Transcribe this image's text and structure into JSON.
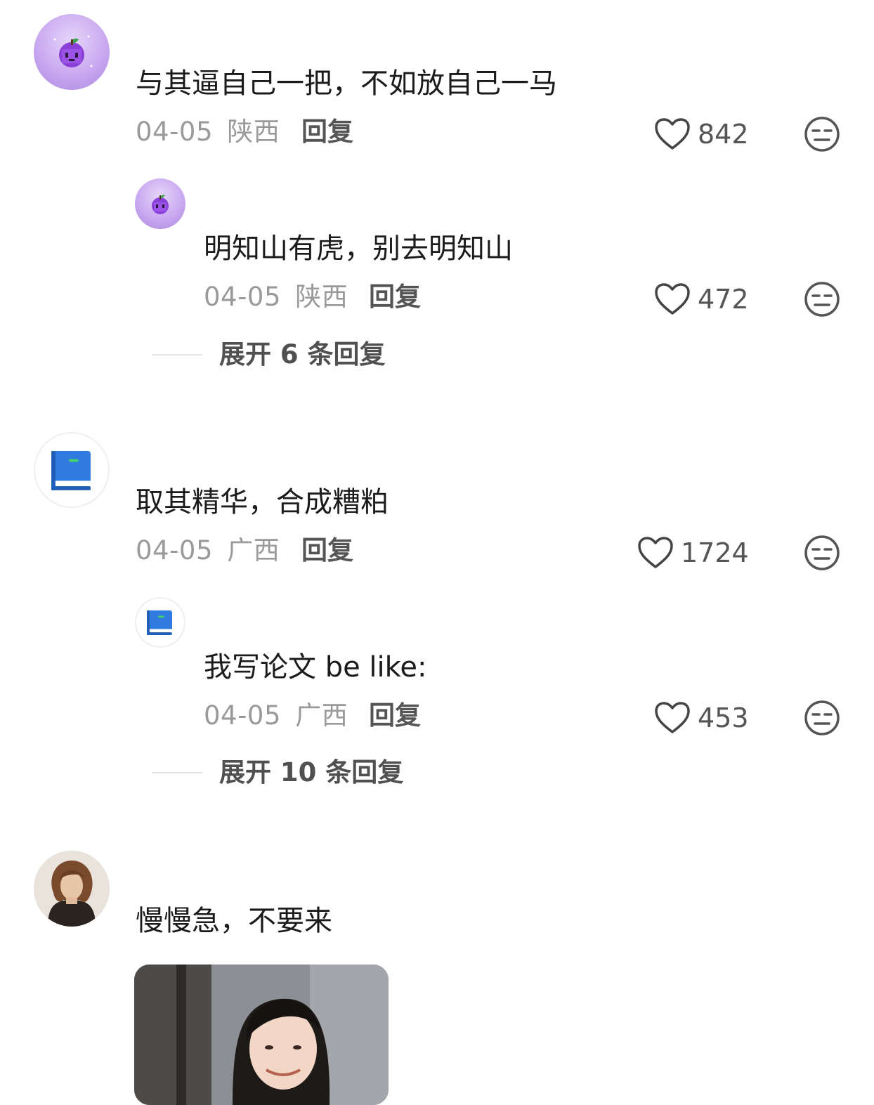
{
  "comments": [
    {
      "text": "与其逼自己一把，不如放自己一马",
      "date": "04-05",
      "location": "陕西",
      "reply_label": "回复",
      "likes": "842",
      "avatar_icon": "grape-icon",
      "replies": [
        {
          "text": "明知山有虎，别去明知山",
          "date": "04-05",
          "location": "陕西",
          "reply_label": "回复",
          "likes": "472",
          "avatar_icon": "grape-icon"
        }
      ],
      "expand_label": "展开 6 条回复"
    },
    {
      "text": "取其精华，合成糟粕",
      "date": "04-05",
      "location": "广西",
      "reply_label": "回复",
      "likes": "1724",
      "avatar_icon": "book-icon",
      "replies": [
        {
          "text": "我写论文 be like:",
          "date": "04-05",
          "location": "广西",
          "reply_label": "回复",
          "likes": "453",
          "avatar_icon": "book-icon"
        }
      ],
      "expand_label": "展开 10 条回复"
    },
    {
      "text": "慢慢急，不要来",
      "avatar_icon": "portrait-photo",
      "attachment": "photo-image"
    }
  ],
  "colors": {
    "text": "#1b1b1b",
    "meta": "#9a9a9a",
    "action": "#555555",
    "avatar_purple": "#c9a9f0",
    "book_blue": "#2f7be0"
  }
}
